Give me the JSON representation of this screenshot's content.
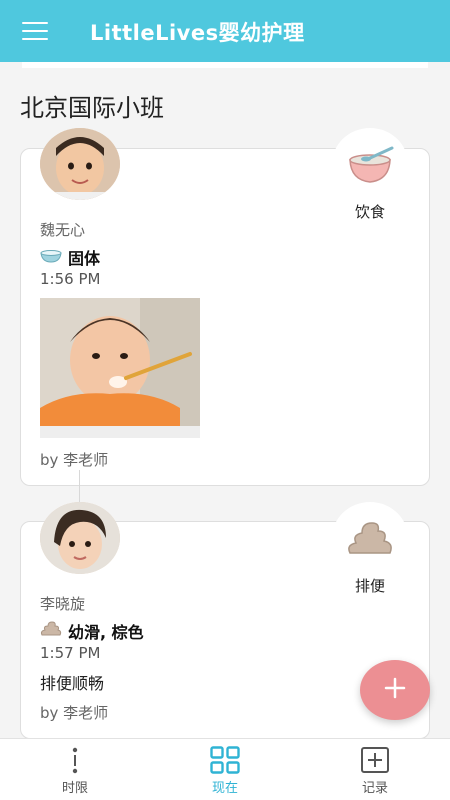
{
  "app": {
    "title": "LittleLives婴幼护理"
  },
  "class_name": "北京国际小班",
  "entries": [
    {
      "type_label": "饮食",
      "child_name": "魏无心",
      "detail": "固体",
      "time": "1:56 PM",
      "note": "",
      "author": "by 李老师",
      "type_icon": "food-bowl-icon",
      "detail_icon": "bowl-icon"
    },
    {
      "type_label": "排便",
      "child_name": "李晓旋",
      "detail": "幼滑, 棕色",
      "time": "1:57 PM",
      "note": "排便顺畅",
      "author": "by 李老师",
      "type_icon": "poop-icon",
      "detail_icon": "poop-icon"
    }
  ],
  "fab": {
    "label": "+"
  },
  "bottom_nav": [
    {
      "label": "时限",
      "icon": "timeline-icon",
      "active": false
    },
    {
      "label": "现在",
      "icon": "grid-icon",
      "active": true
    },
    {
      "label": "记录",
      "icon": "record-icon",
      "active": false
    }
  ],
  "colors": {
    "appbar": "#4fc8de",
    "fab": "#ec8f93",
    "active_nav": "#2fb3d4"
  }
}
